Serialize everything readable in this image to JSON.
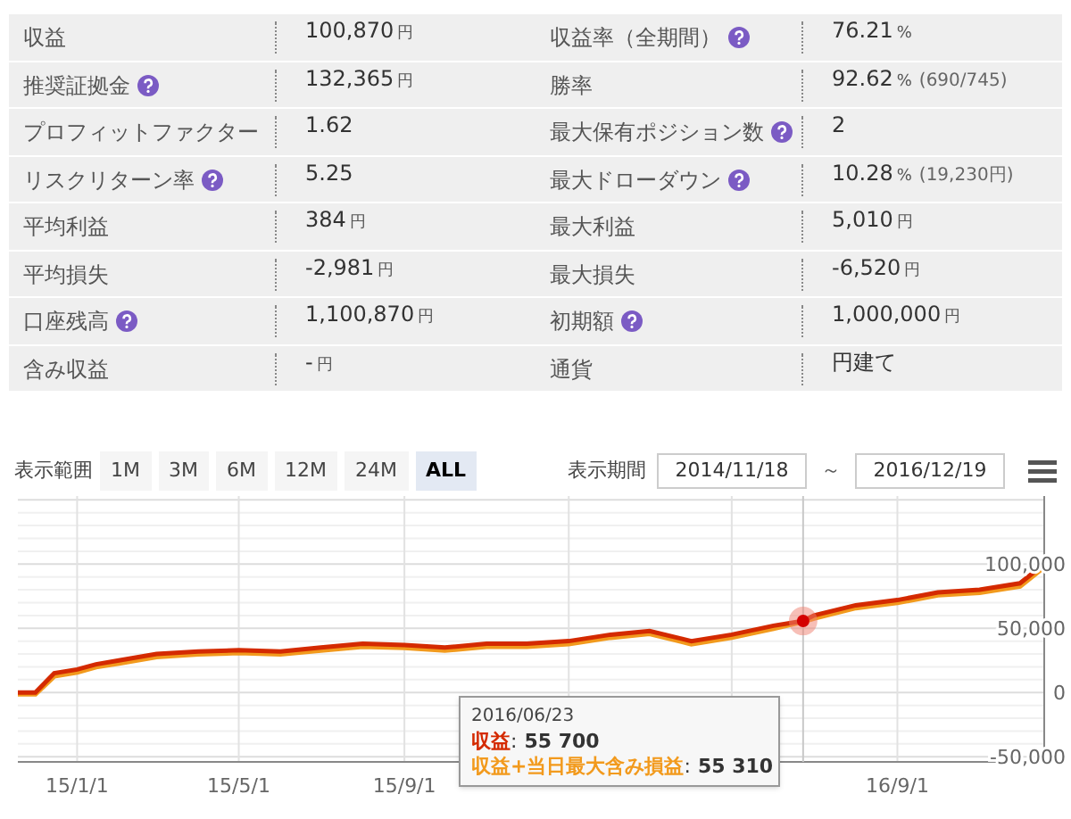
{
  "stats": {
    "rows": [
      [
        {
          "label": "収益",
          "help": false,
          "value": "100,870",
          "unit": "円"
        },
        {
          "label": "収益率（全期間）",
          "help": true,
          "value": "76.21",
          "unit": "%"
        }
      ],
      [
        {
          "label": "推奨証拠金",
          "help": true,
          "value": "132,365",
          "unit": "円"
        },
        {
          "label": "勝率",
          "help": false,
          "value": "92.62",
          "unit": "%",
          "note": "(690/745)"
        }
      ],
      [
        {
          "label": "プロフィットファクター",
          "help": false,
          "value": "1.62"
        },
        {
          "label": "最大保有ポジション数",
          "help": true,
          "value": "2"
        }
      ],
      [
        {
          "label": "リスクリターン率",
          "help": true,
          "value": "5.25"
        },
        {
          "label": "最大ドローダウン",
          "help": true,
          "value": "10.28",
          "unit": "%",
          "note": "(19,230円)"
        }
      ],
      [
        {
          "label": "平均利益",
          "help": false,
          "value": "384",
          "unit": "円"
        },
        {
          "label": "最大利益",
          "help": false,
          "value": "5,010",
          "unit": "円"
        }
      ],
      [
        {
          "label": "平均損失",
          "help": false,
          "value": "-2,981",
          "unit": "円"
        },
        {
          "label": "最大損失",
          "help": false,
          "value": "-6,520",
          "unit": "円"
        }
      ],
      [
        {
          "label": "口座残高",
          "help": true,
          "value": "1,100,870",
          "unit": "円"
        },
        {
          "label": "初期額",
          "help": true,
          "value": "1,000,000",
          "unit": "円"
        }
      ],
      [
        {
          "label": "含み収益",
          "help": false,
          "value": "-",
          "unit": "円"
        },
        {
          "label": "通貨",
          "help": false,
          "value": "円建て"
        }
      ]
    ]
  },
  "controls": {
    "range_label": "表示範囲",
    "ranges": [
      {
        "label": "1M",
        "selected": false
      },
      {
        "label": "3M",
        "selected": false
      },
      {
        "label": "6M",
        "selected": false
      },
      {
        "label": "12M",
        "selected": false
      },
      {
        "label": "24M",
        "selected": false
      },
      {
        "label": "ALL",
        "selected": true
      }
    ],
    "period_label": "表示期間",
    "start_date": "2014/11/18",
    "separator": "～",
    "end_date": "2016/12/19"
  },
  "chart": {
    "chart_data": {
      "type": "line",
      "x": [
        "2014-11-18",
        "2014-12-01",
        "2014-12-15",
        "2015-01-01",
        "2015-01-15",
        "2015-02-01",
        "2015-03-01",
        "2015-04-01",
        "2015-05-01",
        "2015-06-01",
        "2015-07-01",
        "2015-08-01",
        "2015-09-01",
        "2015-10-01",
        "2015-11-01",
        "2015-12-01",
        "2016-01-01",
        "2016-02-01",
        "2016-03-01",
        "2016-04-01",
        "2016-05-01",
        "2016-06-01",
        "2016-06-23",
        "2016-07-01",
        "2016-08-01",
        "2016-09-01",
        "2016-10-01",
        "2016-11-01",
        "2016-12-01",
        "2016-12-19"
      ],
      "series": [
        {
          "name": "収益",
          "color": "#d42a00",
          "values": [
            0,
            0,
            15000,
            18000,
            22000,
            25000,
            30000,
            32000,
            33000,
            32000,
            35000,
            38000,
            37000,
            35000,
            38000,
            38000,
            40000,
            45000,
            48000,
            40000,
            45000,
            52000,
            55700,
            60000,
            68000,
            72000,
            78000,
            80000,
            85000,
            100000
          ]
        },
        {
          "name": "収益+当日最大含み損益",
          "color": "#f29a1d",
          "values": [
            -1000,
            -1000,
            13000,
            16000,
            20000,
            23000,
            28000,
            30000,
            31000,
            30000,
            33000,
            36000,
            35000,
            33000,
            36000,
            36000,
            38000,
            43000,
            46000,
            38000,
            43000,
            50000,
            55310,
            58000,
            66000,
            70000,
            76000,
            78000,
            83000,
            98000
          ]
        }
      ],
      "xticks": [
        {
          "value": "2015-01-01",
          "label": "15/1/1"
        },
        {
          "value": "2015-05-01",
          "label": "15/5/1"
        },
        {
          "value": "2015-09-01",
          "label": "15/9/1"
        },
        {
          "value": "2016-01-01"
        },
        {
          "value": "2016-05-01"
        },
        {
          "value": "2016-09-01",
          "label": "16/9/1"
        }
      ],
      "yticks": [
        {
          "value": 100000,
          "label": "100,000"
        },
        {
          "value": 50000,
          "label": "50,000"
        },
        {
          "value": 0,
          "label": "0"
        },
        {
          "value": -50000,
          "label": "-50,000"
        }
      ],
      "xlim": [
        "2014-11-18",
        "2016-12-19"
      ],
      "ylim": [
        -54000,
        153000
      ],
      "grid": true,
      "ref_lines": [
        {
          "axis": "x",
          "value": "2016-06-23"
        }
      ]
    },
    "tooltip": {
      "date": "2016/06/23",
      "lines": [
        {
          "separator": ":",
          "value": "55 700"
        },
        {
          "separator": ":",
          "value": "55 310"
        }
      ]
    }
  }
}
